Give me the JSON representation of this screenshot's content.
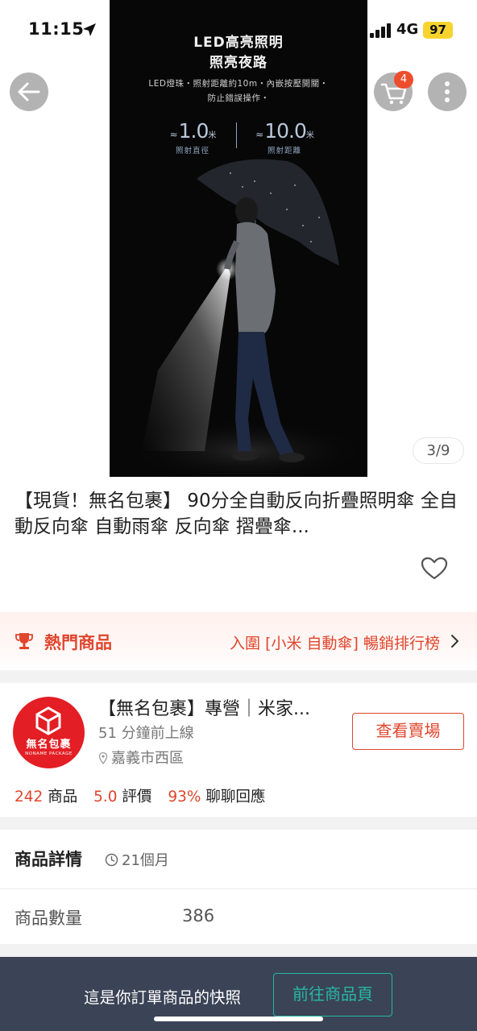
{
  "status_bar": {
    "time": "11:15",
    "network": "4G",
    "battery": "97",
    "battery_color": "#f6d42d"
  },
  "nav": {
    "back_icon": "arrow-left-icon",
    "cart_icon": "cart-icon",
    "cart_count": "4",
    "more_icon": "more-vertical-icon"
  },
  "product_image": {
    "headline_1": "LED高亮照明",
    "headline_2": "照亮夜路",
    "desc_1": "LED燈珠・照射距離約10m・內嵌按壓開關・",
    "desc_2": "防止錯誤操作・",
    "spec_1_approx": "≈",
    "spec_1_value": "1.0",
    "spec_1_unit": "米",
    "spec_1_label": "照射直徑",
    "spec_2_approx": "≈",
    "spec_2_value": "10.0",
    "spec_2_unit": "米",
    "spec_2_label": "照射距離",
    "counter": "3/9"
  },
  "product": {
    "title": "【現貨！無名包裹】 90分全自動反向折疊照明傘 全自動反向傘 自動雨傘 反向傘 摺疊傘...",
    "favorite_icon": "heart-outline-icon"
  },
  "hot": {
    "icon": "trophy-icon",
    "label": "熱門商品",
    "rank_text": "入圍 [小米 自動傘] 暢銷排行榜",
    "accent": "#e0452d"
  },
  "shop": {
    "logo_text": "無名包裹",
    "logo_sub": "NONAME PACKAGE",
    "name": "【無名包裹】專營｜米家...",
    "online": "51 分鐘前上線",
    "location": "嘉義市西區",
    "view_button": "查看賣場",
    "stats": [
      {
        "value": "242",
        "label": "商品"
      },
      {
        "value": "5.0",
        "label": "評價"
      },
      {
        "value": "93%",
        "label": "聊聊回應"
      }
    ]
  },
  "detail": {
    "heading": "商品詳情",
    "age": "21個月",
    "quantity_label": "商品數量",
    "quantity_value": "386"
  },
  "snapshot": {
    "text": "這是你訂單商品的快照",
    "button": "前往商品頁",
    "accent": "#26b7a5"
  }
}
